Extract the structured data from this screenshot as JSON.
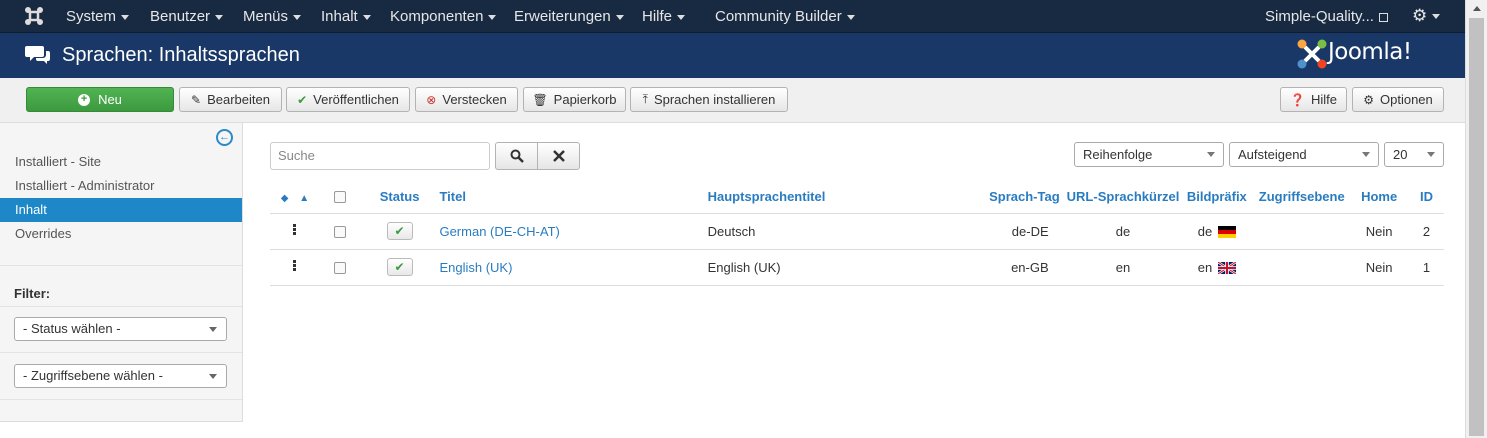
{
  "nav": {
    "items": [
      "System",
      "Benutzer",
      "Menüs",
      "Inhalt",
      "Komponenten",
      "Erweiterungen",
      "Hilfe",
      "Community Builder"
    ],
    "site_link": "Simple-Quality...",
    "settings_icon": "gear-icon"
  },
  "header": {
    "title": "Sprachen: Inhaltssprachen",
    "brand": "Joomla!"
  },
  "toolbar": {
    "new": "Neu",
    "edit": "Bearbeiten",
    "publish": "Veröffentlichen",
    "unpublish": "Verstecken",
    "trash": "Papierkorb",
    "install": "Sprachen installieren",
    "help": "Hilfe",
    "options": "Optionen"
  },
  "sidebar": {
    "items": [
      "Installiert - Site",
      "Installiert - Administrator",
      "Inhalt",
      "Overrides"
    ],
    "active_index": 2,
    "filter_label": "Filter:",
    "status_select": "- Status wählen -",
    "access_select": "- Zugriffsebene wählen -"
  },
  "search": {
    "placeholder": "Suche"
  },
  "list": {
    "ordering": "Reihenfolge",
    "direction": "Aufsteigend",
    "limit": "20"
  },
  "table": {
    "columns": {
      "status": "Status",
      "title": "Titel",
      "native": "Hauptsprachentitel",
      "tag": "Sprach-Tag",
      "sef": "URL-Sprachkürzel",
      "image": "Bildpräfix",
      "access": "Zugriffsebene",
      "home": "Home",
      "id": "ID"
    },
    "rows": [
      {
        "title": "German (DE-CH-AT)",
        "native": "Deutsch",
        "tag": "de-DE",
        "sef": "de",
        "image": "de",
        "flag": "de-flag-icon",
        "access": "",
        "home": "Nein",
        "id": "2"
      },
      {
        "title": "English (UK)",
        "native": "English (UK)",
        "tag": "en-GB",
        "sef": "en",
        "image": "en",
        "flag": "uk-flag-icon",
        "access": "",
        "home": "Nein",
        "id": "1"
      }
    ]
  }
}
